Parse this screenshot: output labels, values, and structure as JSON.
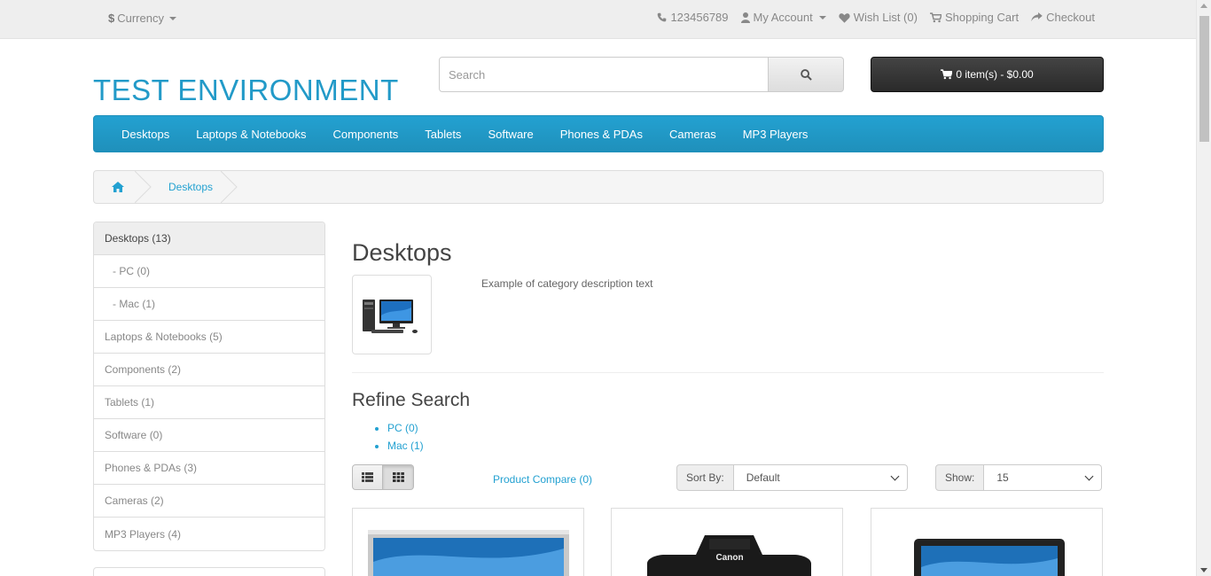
{
  "topbar": {
    "currency_symbol": "$",
    "currency_label": "Currency",
    "phone": "123456789",
    "my_account": "My Account",
    "wish_list": "Wish List (0)",
    "shopping_cart": "Shopping Cart",
    "checkout": "Checkout"
  },
  "header": {
    "logo": "TEST ENVIRONMENT",
    "search_placeholder": "Search",
    "cart_label": "0 item(s) - $0.00"
  },
  "menu": {
    "items": [
      "Desktops",
      "Laptops & Notebooks",
      "Components",
      "Tablets",
      "Software",
      "Phones & PDAs",
      "Cameras",
      "MP3 Players"
    ]
  },
  "breadcrumb": {
    "current": "Desktops"
  },
  "sidebar": {
    "items": [
      {
        "label": "Desktops (13)"
      },
      {
        "label": "- PC (0)"
      },
      {
        "label": "- Mac (1)"
      },
      {
        "label": "Laptops & Notebooks (5)"
      },
      {
        "label": "Components (2)"
      },
      {
        "label": "Tablets (1)"
      },
      {
        "label": "Software (0)"
      },
      {
        "label": "Phones & PDAs (3)"
      },
      {
        "label": "Cameras (2)"
      },
      {
        "label": "MP3 Players (4)"
      }
    ]
  },
  "content": {
    "title": "Desktops",
    "description": "Example of category description text",
    "refine_title": "Refine Search",
    "refine_links": [
      "PC (0)",
      "Mac (1)"
    ],
    "product_compare": "Product Compare (0)",
    "sort_label": "Sort By:",
    "sort_value": "Default",
    "show_label": "Show:",
    "show_value": "15"
  },
  "colors": {
    "accent": "#229ac8",
    "menu_bg": "#23a1d1",
    "cart_bg": "#333333"
  }
}
